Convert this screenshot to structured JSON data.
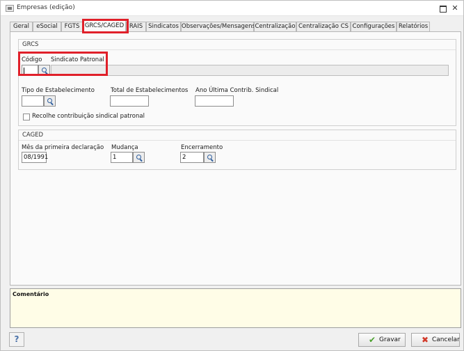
{
  "window": {
    "title": "Empresas (edição)",
    "maximize_icon": "maximize-icon",
    "close_icon": "close-icon",
    "close_glyph": "✕"
  },
  "tabs": [
    {
      "label": "Geral"
    },
    {
      "label": "eSocial"
    },
    {
      "label": "FGTS"
    },
    {
      "label": "GRCS/CAGED",
      "active": true
    },
    {
      "label": "RAIS"
    },
    {
      "label": "Sindicatos"
    },
    {
      "label": "Observações/Mensagens"
    },
    {
      "label": "Centralização"
    },
    {
      "label": "Centralização CS"
    },
    {
      "label": "Configurações"
    },
    {
      "label": "Relatórios"
    }
  ],
  "grcs": {
    "title": "GRCS",
    "codigo_label": "Código",
    "codigo_value": "",
    "sindicato_label": "Sindicato Patronal",
    "sindicato_value": "",
    "tipo_label": "Tipo de Estabelecimento",
    "tipo_value": "",
    "total_label": "Total de Estabelecimentos",
    "total_value": "",
    "ano_label": "Ano Última Contrib. Sindical",
    "ano_value": "",
    "recolhe_label": "Recolhe contribuição sindical patronal",
    "recolhe_checked": false
  },
  "caged": {
    "title": "CAGED",
    "mes_label": "Mês da primeira declaração",
    "mes_value": "08/1991",
    "mudanca_label": "Mudança",
    "mudanca_value": "1",
    "encerramento_label": "Encerramento",
    "encerramento_value": "2"
  },
  "comment": {
    "label": "Comentário",
    "value": ""
  },
  "footer": {
    "help_label": "?",
    "save_label": "Gravar",
    "cancel_label": "Cancelar",
    "save_icon": "check-icon",
    "cancel_icon": "x-icon",
    "save_glyph": "✔",
    "cancel_glyph": "✖"
  },
  "colors": {
    "highlight": "#e0202a",
    "comment_bg": "#fffde7",
    "save_icon": "#4aa02c",
    "cancel_icon": "#d23a2a"
  }
}
